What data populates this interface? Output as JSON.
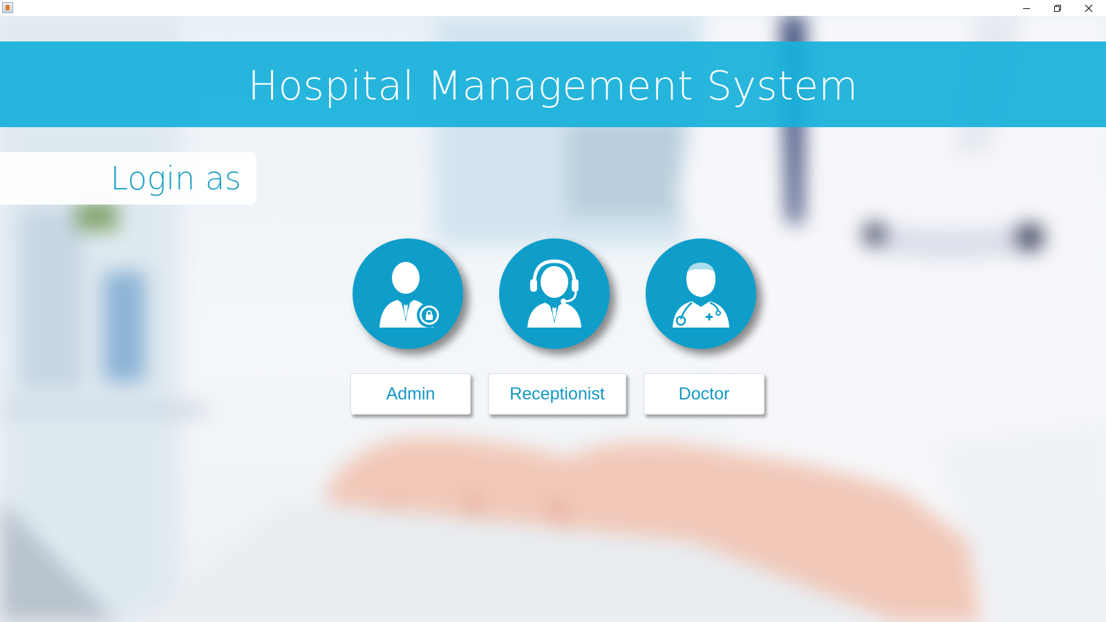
{
  "window": {
    "app_icon": "java-cup-icon",
    "controls": [
      "minimize-icon",
      "restore-icon",
      "close-icon"
    ]
  },
  "header": {
    "title": "Hospital Management System",
    "banner_color": "#18b0da"
  },
  "login": {
    "label": "Login as"
  },
  "roles": [
    {
      "id": "admin",
      "label": "Admin",
      "icon": "admin-user-lock-icon"
    },
    {
      "id": "receptionist",
      "label": "Receptionist",
      "icon": "receptionist-headset-icon"
    },
    {
      "id": "doctor",
      "label": "Doctor",
      "icon": "doctor-stethoscope-icon"
    }
  ],
  "colors": {
    "accent": "#0f9ec9",
    "text_accent": "#1697c4",
    "button_bg": "#ffffff"
  }
}
